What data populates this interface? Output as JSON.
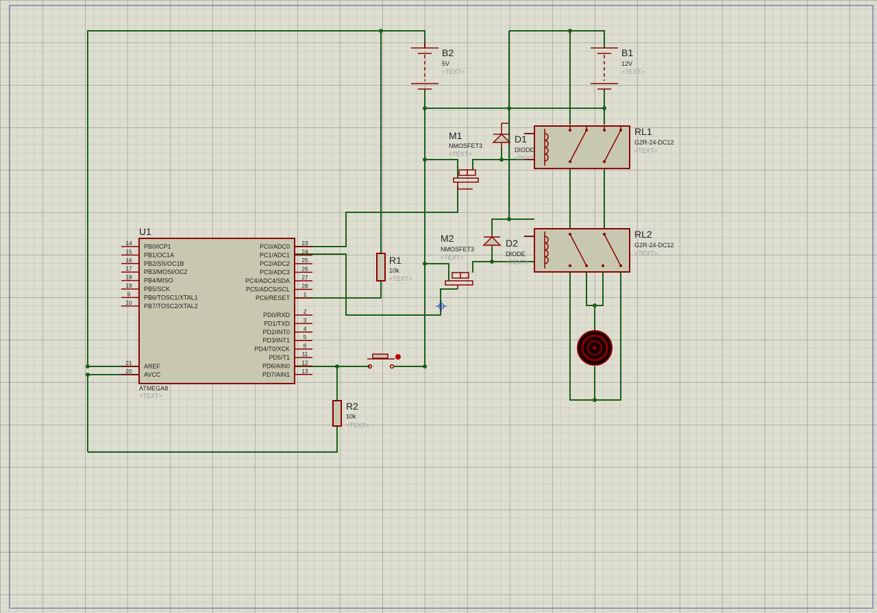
{
  "schematic": {
    "components": {
      "u1": {
        "ref": "U1",
        "value": "ATMEGA8",
        "text": "<TEXT>"
      },
      "b2": {
        "ref": "B2",
        "value": "5V",
        "text": "<TEXT>"
      },
      "b1": {
        "ref": "B1",
        "value": "12V",
        "text": "<TEXT>"
      },
      "m1": {
        "ref": "M1",
        "value": "NMOSFET3",
        "text": "<TEXT>"
      },
      "m2": {
        "ref": "M2",
        "value": "NMOSFET3",
        "text": "<TEXT>"
      },
      "d1": {
        "ref": "D1",
        "value": "DIODE",
        "text": "<TEXT>"
      },
      "d2": {
        "ref": "D2",
        "value": "DIODE",
        "text": "<TEXT>"
      },
      "rl1": {
        "ref": "RL1",
        "value": "G2R-24-DC12",
        "text": "<TEXT>"
      },
      "rl2": {
        "ref": "RL2",
        "value": "G2R-24-DC12",
        "text": "<TEXT>"
      },
      "r1": {
        "ref": "R1",
        "value": "10k",
        "text": "<TEXT>"
      },
      "r2": {
        "ref": "R2",
        "value": "10k",
        "text": "<TEXT>"
      }
    },
    "u1_left_pins": [
      {
        "num": "14",
        "name": "PB0/ICP1"
      },
      {
        "num": "15",
        "name": "PB1/OC1A"
      },
      {
        "num": "16",
        "name": "PB2/SS/OC1B"
      },
      {
        "num": "17",
        "name": "PB3/MOSI/OC2"
      },
      {
        "num": "18",
        "name": "PB4/MISO"
      },
      {
        "num": "19",
        "name": "PB5/SCK"
      },
      {
        "num": "9",
        "name": "PB6/TOSC1/XTAL1"
      },
      {
        "num": "10",
        "name": "PB7/TOSC2/XTAL2"
      }
    ],
    "u1_left_pins_bottom": [
      {
        "num": "21",
        "name": "AREF"
      },
      {
        "num": "20",
        "name": "AVCC"
      }
    ],
    "u1_right_pins_top": [
      {
        "num": "23",
        "name": "PC0/ADC0"
      },
      {
        "num": "24",
        "name": "PC1/ADC1"
      },
      {
        "num": "25",
        "name": "PC2/ADC2"
      },
      {
        "num": "26",
        "name": "PC3/ADC3"
      },
      {
        "num": "27",
        "name": "PC4/ADC4/SDA"
      },
      {
        "num": "28",
        "name": "PC5/ADC5/SCL"
      },
      {
        "num": "1",
        "name": "PC6/RESET"
      }
    ],
    "u1_right_pins_bottom": [
      {
        "num": "2",
        "name": "PD0/RXD"
      },
      {
        "num": "3",
        "name": "PD1/TXD"
      },
      {
        "num": "4",
        "name": "PD2/INT0"
      },
      {
        "num": "5",
        "name": "PD3/INT1"
      },
      {
        "num": "6",
        "name": "PD4/T0/XCK"
      },
      {
        "num": "11",
        "name": "PD5/T1"
      },
      {
        "num": "12",
        "name": "PD6/AIN0"
      },
      {
        "num": "13",
        "name": "PD7/AIN1"
      }
    ],
    "colors": {
      "wire": "#1a5e1a",
      "component": "#8a0000",
      "body": "#c8c8b0",
      "grid": "#deded0"
    }
  }
}
